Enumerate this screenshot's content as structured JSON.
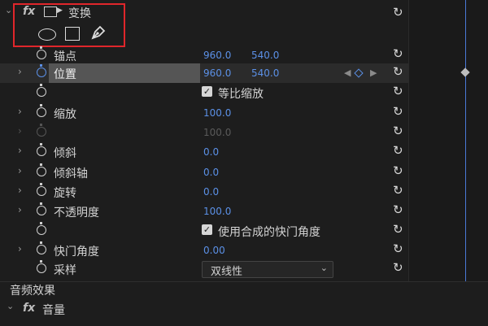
{
  "transform": {
    "fx": "fx",
    "title": "变换",
    "shape_tools": [
      "ellipse-mask-icon",
      "rectangle-mask-icon",
      "pen-mask-icon"
    ]
  },
  "properties": {
    "anchor": {
      "label": "锚点",
      "x": "960.0",
      "y": "540.0"
    },
    "position": {
      "label": "位置",
      "x": "960.0",
      "y": "540.0"
    },
    "uniform_scale": {
      "label": "等比缩放",
      "checked": true
    },
    "scale": {
      "label": "缩放",
      "value": "100.0"
    },
    "scale_width": {
      "value": "100.0"
    },
    "skew": {
      "label": "倾斜",
      "value": "0.0"
    },
    "skew_axis": {
      "label": "倾斜轴",
      "value": "0.0"
    },
    "rotation": {
      "label": "旋转",
      "value": "0.0"
    },
    "opacity": {
      "label": "不透明度",
      "value": "100.0"
    },
    "use_comp_shutter": {
      "label": "使用合成的快门角度",
      "checked": true
    },
    "shutter_angle": {
      "label": "快门角度",
      "value": "0.00"
    },
    "sampling": {
      "label": "采样",
      "value": "双线性"
    }
  },
  "audio": {
    "section_title": "音频效果",
    "fx": "fx",
    "volume": "音量"
  },
  "colors": {
    "accent": "#5b90e6",
    "highlight_box": "#e0262b"
  }
}
